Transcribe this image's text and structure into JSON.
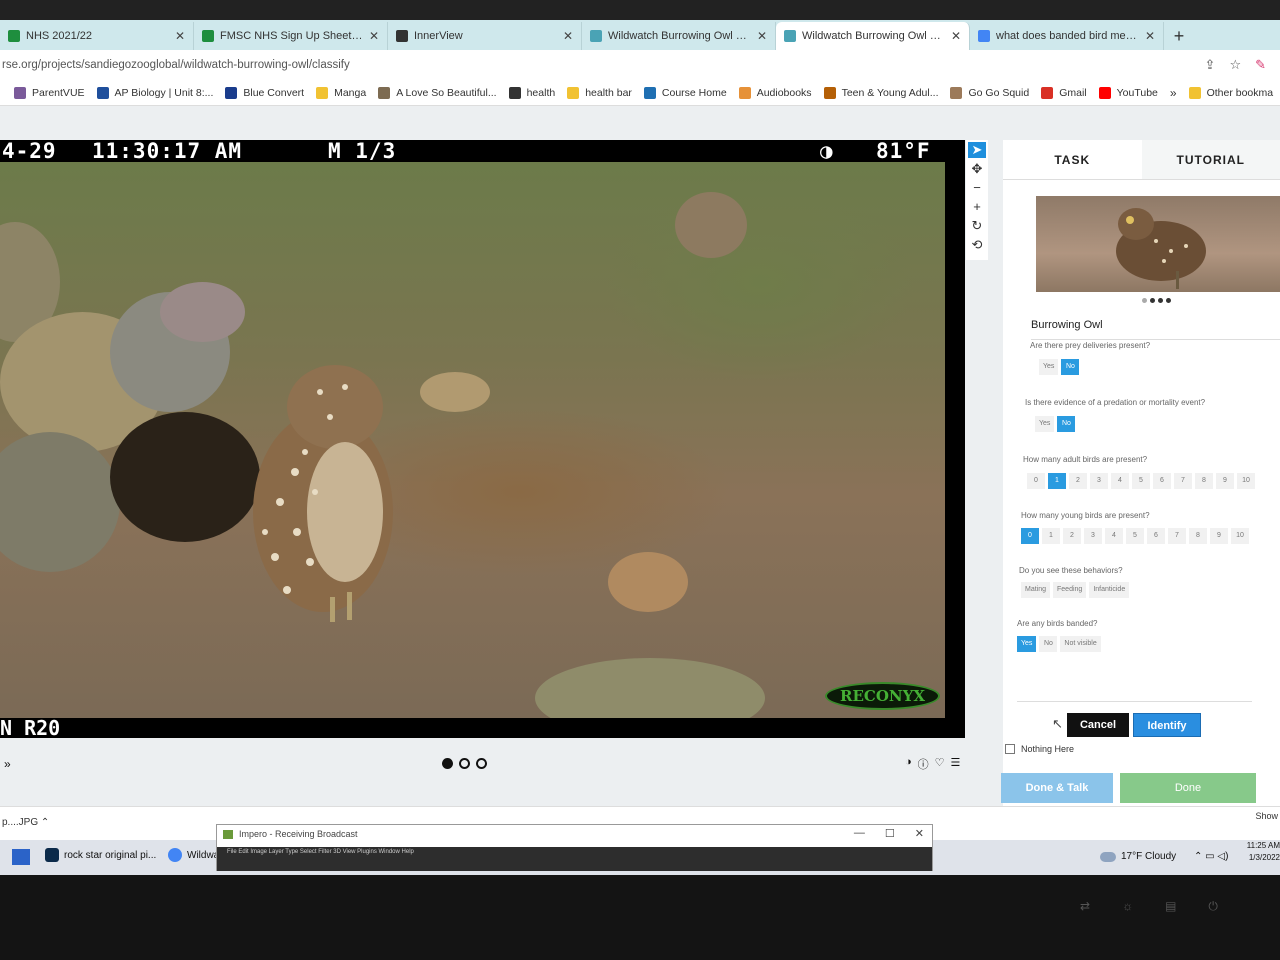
{
  "browser": {
    "tabs": [
      {
        "label": "NHS 2021/22",
        "icon_color": "#1e8e3e",
        "active": false
      },
      {
        "label": "FMSC NHS Sign Up Sheet - Goo",
        "icon_color": "#1e8e3e",
        "active": false
      },
      {
        "label": "InnerView",
        "icon_color": "#333333",
        "active": false
      },
      {
        "label": "Wildwatch Burrowing Owl » Cla",
        "icon_color": "#4aa3b5",
        "active": false
      },
      {
        "label": "Wildwatch Burrowing Owl » Cla",
        "icon_color": "#4aa3b5",
        "active": true
      },
      {
        "label": "what does banded bird mean -",
        "icon_color": "#4285f4",
        "active": false
      }
    ],
    "new_tab": "+",
    "url": "rse.org/projects/sandiegozooglobal/wildwatch-burrowing-owl/classify",
    "bookmarks": [
      {
        "label": "ParentVUE",
        "icon_color": "#7a5a9a"
      },
      {
        "label": "AP Biology | Unit 8:...",
        "icon_color": "#1f4f9c"
      },
      {
        "label": "Blue Convert",
        "icon_color": "#1a3c8c"
      },
      {
        "label": "Manga",
        "icon_color": "#f1c232"
      },
      {
        "label": "A Love So Beautiful...",
        "icon_color": "#7d6b52"
      },
      {
        "label": "health",
        "icon_color": "#333333"
      },
      {
        "label": "health bar",
        "icon_color": "#f1c232"
      },
      {
        "label": "Course Home",
        "icon_color": "#1f6fb2"
      },
      {
        "label": "Audiobooks",
        "icon_color": "#e69138"
      },
      {
        "label": "Teen & Young Adul...",
        "icon_color": "#b45f06"
      },
      {
        "label": "Go Go Squid",
        "icon_color": "#9c7a5a"
      },
      {
        "label": "Gmail",
        "icon_color": "#d93025"
      },
      {
        "label": "YouTube",
        "icon_color": "#ff0000"
      }
    ],
    "bookmarks_more": "»",
    "other_bookmarks": "Other bookma"
  },
  "camera": {
    "date": "4-29",
    "time": "11:30:17 AM",
    "frame": "M 1/3",
    "temperature": "81°F",
    "camera_id": "N R20",
    "brand": "RECONYX"
  },
  "viewer": {
    "subject_dots": [
      true,
      false,
      false
    ],
    "tools": [
      "pointer",
      "move",
      "zoom-out",
      "zoom-in",
      "rotate",
      "reset"
    ],
    "expand": "»"
  },
  "task_panel": {
    "tabs": [
      "TASK",
      "TUTORIAL"
    ],
    "species": "Burrowing Owl",
    "questions": [
      {
        "text": "Are there prey deliveries present?",
        "options": [
          "Yes",
          "No"
        ],
        "selected": "No"
      },
      {
        "text": "Is there evidence of a predation or mortality event?",
        "options": [
          "Yes",
          "No"
        ],
        "selected": "No"
      },
      {
        "text": "How many adult birds are present?",
        "options": [
          "0",
          "1",
          "2",
          "3",
          "4",
          "5",
          "6",
          "7",
          "8",
          "9",
          "10"
        ],
        "selected": "1"
      },
      {
        "text": "How many young birds are present?",
        "options": [
          "0",
          "1",
          "2",
          "3",
          "4",
          "5",
          "6",
          "7",
          "8",
          "9",
          "10"
        ],
        "selected": "0"
      },
      {
        "text": "Do you see these behaviors?",
        "options": [
          "Mating",
          "Feeding",
          "Infanticide"
        ],
        "selected": ""
      },
      {
        "text": "Are any birds banded?",
        "options": [
          "Yes",
          "No",
          "Not visible"
        ],
        "selected": "Yes"
      }
    ],
    "cancel_label": "Cancel",
    "identify_label": "Identify",
    "nothing_here_label": "Nothing Here",
    "done_talk_label": "Done & Talk",
    "done_label": "Done"
  },
  "download_shelf": {
    "file": "p....JPG",
    "show_all": "Show"
  },
  "impero": {
    "title": "Impero - Receiving Broadcast",
    "menu": "File  Edit  Image  Layer  Type  Select  Filter  3D  View  Plugins  Window  Help"
  },
  "taskbar": {
    "apps": [
      {
        "label": "rock star original pi...",
        "icon_color": "#0b2a4a"
      },
      {
        "label": "Wildwa",
        "icon_color": "#4285f4"
      }
    ],
    "weather": "17°F  Cloudy",
    "time": "11:25 AM",
    "date": "1/3/2022"
  }
}
